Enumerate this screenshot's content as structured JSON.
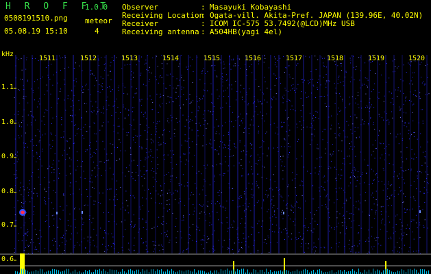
{
  "header": {
    "app_title": "H R O F F T",
    "version": "1.0.0",
    "filename": "0508191510.png",
    "datetime": "05.08.19 15:10",
    "meteor_label": "meteor",
    "meteor_count": "4"
  },
  "info": [
    {
      "label": "Observer",
      "value": "Masayuki Kobayashi"
    },
    {
      "label": "Receiving Location",
      "value": "Ogata-vill. Akita-Pref. JAPAN (139.96E, 40.02N)"
    },
    {
      "label": "Receiver",
      "value": "ICOM IC-575 53.7492(@LCD)MHz USB"
    },
    {
      "label": "Receiving antenna",
      "value": "A504HB(yagi 4el)"
    }
  ],
  "axes": {
    "y_unit": "kHz",
    "y_ticks": [
      "1.1",
      "1.0",
      "0.9",
      "0.8",
      "0.7",
      "0.6"
    ],
    "x_ticks": [
      "1511",
      "1512",
      "1513",
      "1514",
      "1515",
      "1516",
      "1517",
      "1518",
      "1519",
      "1520"
    ]
  },
  "colors": {
    "background": "#000000",
    "text": "#ffff00",
    "title": "#36e04a",
    "noise": "#2a2aff",
    "echo": "#ff3050"
  }
}
